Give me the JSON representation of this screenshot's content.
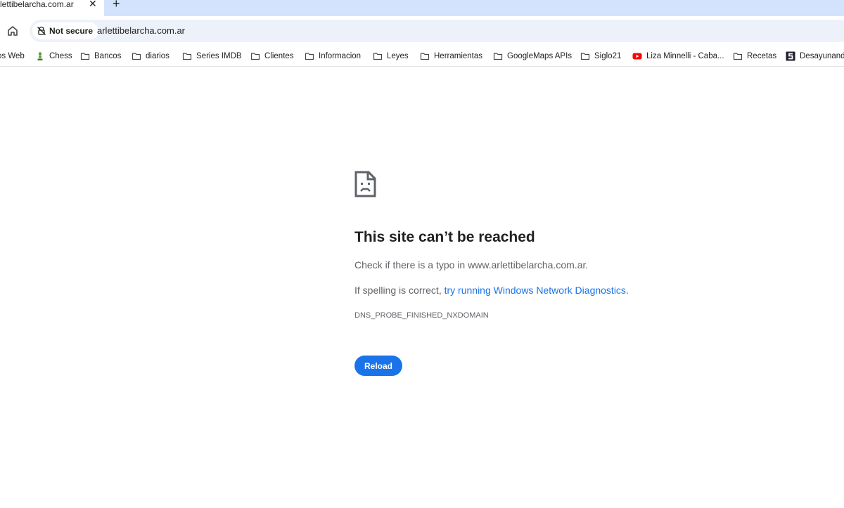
{
  "tab": {
    "title": "lettibelarcha.com.ar",
    "close_glyph": "✕",
    "new_tab_glyph": "+"
  },
  "toolbar": {
    "home_icon": "home-icon",
    "security_label": "Not secure",
    "security_icon": "not-secure-icon",
    "url": "arlettibelarcha.com.ar"
  },
  "bookmarks": [
    {
      "label": "os Web",
      "icon": "none"
    },
    {
      "label": "Chess",
      "icon": "chess-pawn-icon"
    },
    {
      "label": "Bancos",
      "icon": "folder-icon"
    },
    {
      "label": "diarios",
      "icon": "folder-icon"
    },
    {
      "label": "Series IMDB",
      "icon": "folder-icon"
    },
    {
      "label": "Clientes",
      "icon": "folder-icon"
    },
    {
      "label": "Informacion",
      "icon": "folder-icon"
    },
    {
      "label": "Leyes",
      "icon": "folder-icon"
    },
    {
      "label": "Herramientas",
      "icon": "folder-icon"
    },
    {
      "label": "GoogleMaps APIs",
      "icon": "folder-icon"
    },
    {
      "label": "Siglo21",
      "icon": "folder-icon"
    },
    {
      "label": "Liza Minnelli - Caba...",
      "icon": "youtube-icon"
    },
    {
      "label": "Recetas",
      "icon": "folder-icon"
    },
    {
      "label": "Desayunando",
      "icon": "site-s-icon"
    }
  ],
  "error": {
    "icon": "sad-page-icon",
    "title": "This site can’t be reached",
    "line1": "Check if there is a typo in www.arlettibelarcha.com.ar.",
    "line2_prefix": "If spelling is correct, ",
    "line2_link": "try running Windows Network Diagnostics",
    "line2_suffix": ".",
    "code": "DNS_PROBE_FINISHED_NXDOMAIN",
    "reload_label": "Reload"
  },
  "colors": {
    "accent": "#1a73e8",
    "tabstrip": "#d3e3fd",
    "omnibox": "#edf2fa",
    "secondary_text": "#5f6368"
  }
}
